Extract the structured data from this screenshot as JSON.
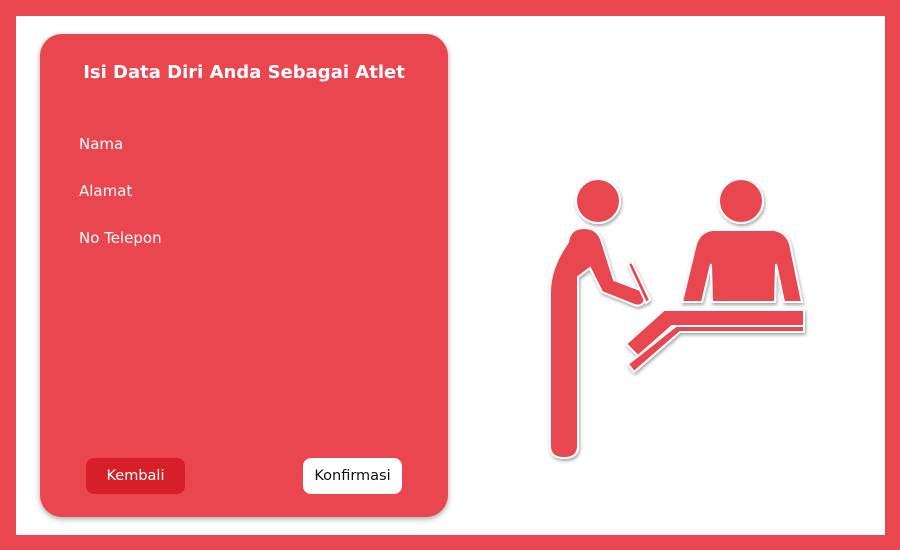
{
  "form": {
    "title": "Isi Data Diri Anda Sebagai Atlet",
    "fields": [
      {
        "label": "Nama"
      },
      {
        "label": "Alamat"
      },
      {
        "label": "No Telepon"
      }
    ],
    "buttons": {
      "back_label": "Kembali",
      "confirm_label": "Konfirmasi"
    }
  },
  "illustration": {
    "icon": "registration-desk-icon",
    "color": "#e9464f"
  },
  "colors": {
    "accent": "#e9464f",
    "back_button": "#d61f26",
    "confirm_button": "#ffffff"
  }
}
